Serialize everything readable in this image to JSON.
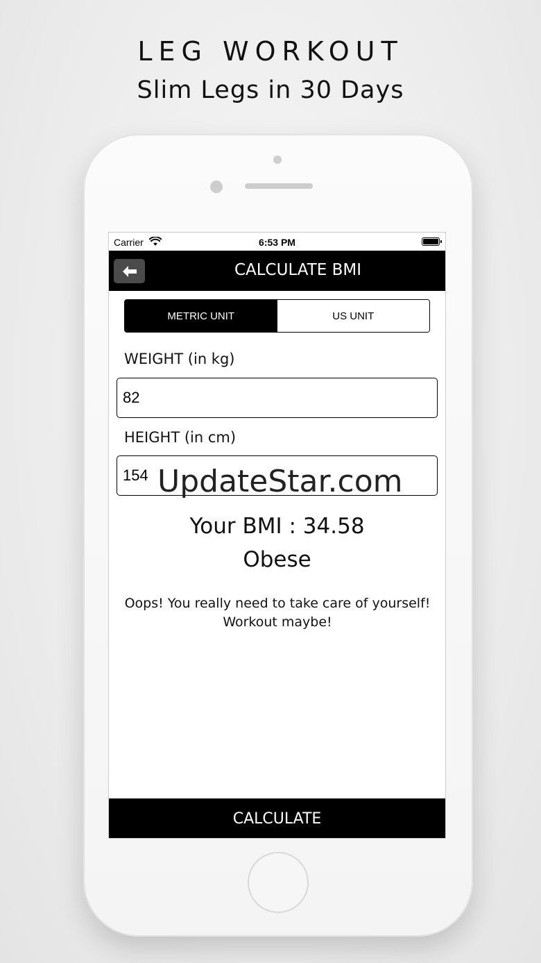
{
  "promo": {
    "title": "LEG WORKOUT",
    "subtitle": "Slim Legs in 30 Days"
  },
  "status_bar": {
    "carrier": "Carrier",
    "time": "6:53 PM",
    "wifi_icon": "wifi-icon",
    "battery_icon": "battery-icon",
    "battery_level": 1.0
  },
  "nav": {
    "back_icon": "arrow-left-icon",
    "title": "CALCULATE BMI"
  },
  "units": {
    "options": [
      "METRIC UNIT",
      "US UNIT"
    ],
    "selected": "METRIC UNIT"
  },
  "form": {
    "weight_label": "WEIGHT (in kg)",
    "weight_value": "82",
    "height_label": "HEIGHT (in cm)",
    "height_value": "154"
  },
  "result": {
    "bmi_text": "Your BMI : 34.58",
    "category": "Obese",
    "advice_line1": "Oops! You really need to take care of yourself!",
    "advice_line2": "Workout maybe!"
  },
  "actions": {
    "calculate_label": "CALCULATE"
  },
  "watermark": "UpdateStar.com",
  "colors": {
    "primary": "#000000",
    "background": "#ffffff",
    "back_button_bg": "#4b4b4b"
  }
}
